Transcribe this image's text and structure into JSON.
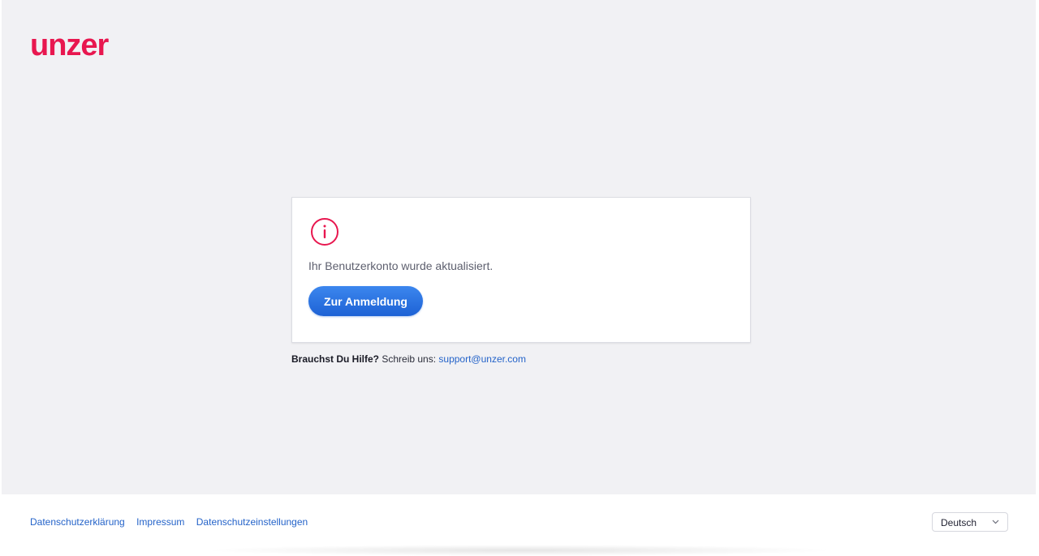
{
  "brand": {
    "logo_text": "unzer",
    "accent_color": "#e8174f",
    "link_color": "#2463c9",
    "button_color": "#2a73e0"
  },
  "card": {
    "icon": "info-circle-icon",
    "message": "Ihr Benutzerkonto wurde aktualisiert.",
    "button_label": "Zur Anmeldung"
  },
  "help": {
    "question": "Brauchst Du Hilfe?",
    "prompt": "Schreib uns:",
    "email": "support@unzer.com"
  },
  "footer": {
    "links": [
      {
        "label": "Datenschutzerklärung"
      },
      {
        "label": "Impressum"
      },
      {
        "label": "Datenschutzeinstellungen"
      }
    ],
    "language": {
      "selected": "Deutsch",
      "icon": "chevron-down-icon"
    }
  }
}
